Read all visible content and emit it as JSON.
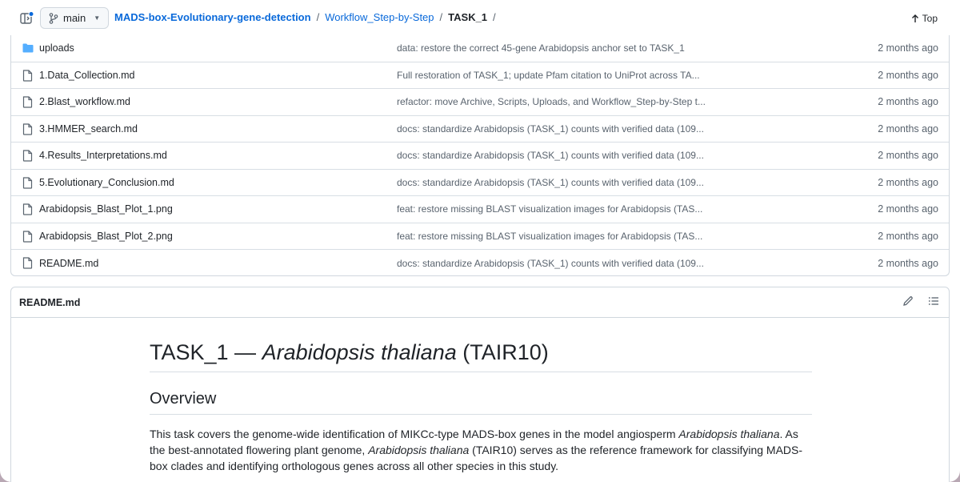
{
  "header": {
    "branch": "main",
    "breadcrumb": {
      "repo": "MADS-box-Evolutionary-gene-detection",
      "folder": "Workflow_Step-by-Step",
      "current": "TASK_1",
      "sep": "/"
    },
    "top_label": "Top"
  },
  "files": [
    {
      "name": "uploads",
      "type": "folder",
      "message": "data: restore the correct 45-gene Arabidopsis anchor set to TASK_1",
      "date": "2 months ago"
    },
    {
      "name": "1.Data_Collection.md",
      "type": "file",
      "message": "Full restoration of TASK_1; update Pfam citation to UniProt across TA...",
      "date": "2 months ago"
    },
    {
      "name": "2.Blast_workflow.md",
      "type": "file",
      "message": "refactor: move Archive, Scripts, Uploads, and Workflow_Step-by-Step t...",
      "date": "2 months ago"
    },
    {
      "name": "3.HMMER_search.md",
      "type": "file",
      "message": "docs: standardize Arabidopsis (TASK_1) counts with verified data (109...",
      "date": "2 months ago"
    },
    {
      "name": "4.Results_Interpretations.md",
      "type": "file",
      "message": "docs: standardize Arabidopsis (TASK_1) counts with verified data (109...",
      "date": "2 months ago"
    },
    {
      "name": "5.Evolutionary_Conclusion.md",
      "type": "file",
      "message": "docs: standardize Arabidopsis (TASK_1) counts with verified data (109...",
      "date": "2 months ago"
    },
    {
      "name": "Arabidopsis_Blast_Plot_1.png",
      "type": "file",
      "message": "feat: restore missing BLAST visualization images for Arabidopsis (TAS...",
      "date": "2 months ago"
    },
    {
      "name": "Arabidopsis_Blast_Plot_2.png",
      "type": "file",
      "message": "feat: restore missing BLAST visualization images for Arabidopsis (TAS...",
      "date": "2 months ago"
    },
    {
      "name": "README.md",
      "type": "file",
      "message": "docs: standardize Arabidopsis (TASK_1) counts with verified data (109...",
      "date": "2 months ago"
    }
  ],
  "readme": {
    "filename": "README.md",
    "h1_prefix": "TASK_1 — ",
    "h1_species": "Arabidopsis thaliana",
    "h1_suffix": " (TAIR10)",
    "h2": "Overview",
    "p_part1": "This task covers the genome-wide identification of MIKCc-type MADS-box genes in the model angiosperm ",
    "p_em1": "Arabidopsis thaliana",
    "p_part2": ". As the best-annotated flowering plant genome, ",
    "p_em2": "Arabidopsis thaliana",
    "p_part3": " (TAIR10) serves as the reference framework for classifying MADS-box clades and identifying orthologous genes across all other species in this study."
  },
  "colors": {
    "link": "#0969da",
    "folder_icon": "#54aeff",
    "notification_dot": "#0969da"
  }
}
